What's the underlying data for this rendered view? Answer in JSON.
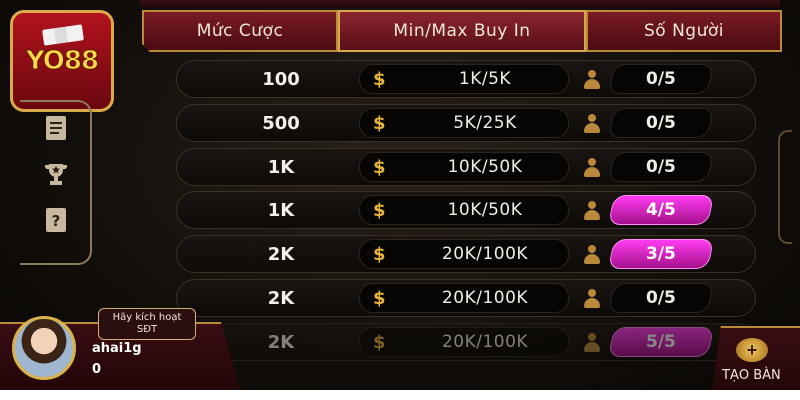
{
  "logo": {
    "text": "YO88"
  },
  "table_headers": {
    "bet": "Mức Cược",
    "buyin": "Min/Max Buy In",
    "players": "Số Người"
  },
  "rows": [
    {
      "bet": "100",
      "currency": "$",
      "buyin": "1K/5K",
      "players": "0/5",
      "active": false
    },
    {
      "bet": "500",
      "currency": "$",
      "buyin": "5K/25K",
      "players": "0/5",
      "active": false
    },
    {
      "bet": "1K",
      "currency": "$",
      "buyin": "10K/50K",
      "players": "0/5",
      "active": false
    },
    {
      "bet": "1K",
      "currency": "$",
      "buyin": "10K/50K",
      "players": "4/5",
      "active": true
    },
    {
      "bet": "2K",
      "currency": "$",
      "buyin": "20K/100K",
      "players": "3/5",
      "active": true
    },
    {
      "bet": "2K",
      "currency": "$",
      "buyin": "20K/100K",
      "players": "0/5",
      "active": false
    },
    {
      "bet": "2K",
      "currency": "$",
      "buyin": "20K/100K",
      "players": "5/5",
      "active": true
    }
  ],
  "side_menu": {
    "icons": [
      "document-icon",
      "trophy-icon",
      "help-icon"
    ]
  },
  "player": {
    "activate_line1": "Hãy kích hoạt",
    "activate_line2": "SĐT",
    "username": "ahai1g",
    "balance": "0"
  },
  "create_table": {
    "label": "TẠO BÀN"
  },
  "colors": {
    "accent_gold": "#d9a94a",
    "active_players": "#ff3cf0",
    "header_red": "#7a1a22"
  }
}
